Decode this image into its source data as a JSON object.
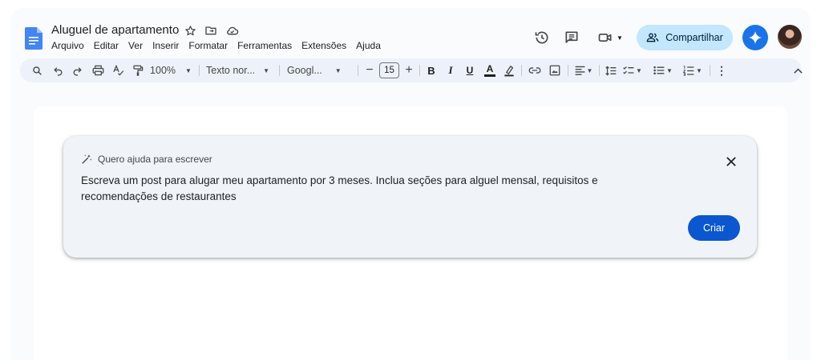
{
  "document": {
    "title": "Aluguel de apartamento"
  },
  "menu": [
    "Arquivo",
    "Editar",
    "Ver",
    "Inserir",
    "Formatar",
    "Ferramentas",
    "Extensões",
    "Ajuda"
  ],
  "header": {
    "share_label": "Compartilhar"
  },
  "toolbar": {
    "zoom": "100%",
    "style": "Texto nor...",
    "font": "Googl...",
    "font_size": "15",
    "bold": "B",
    "italic": "I",
    "underline": "U",
    "text_color": "A"
  },
  "help_me_write": {
    "heading": "Quero ajuda para escrever",
    "prompt": "Escreva um post para alugar meu apartamento por 3 meses. Inclua seções para alguel mensal, requisitos e recomendações de restaurantes",
    "create_label": "Criar"
  },
  "colors": {
    "accent": "#0b57d0",
    "share_bg": "#c2e7ff",
    "docs_blue": "#4285f4"
  }
}
